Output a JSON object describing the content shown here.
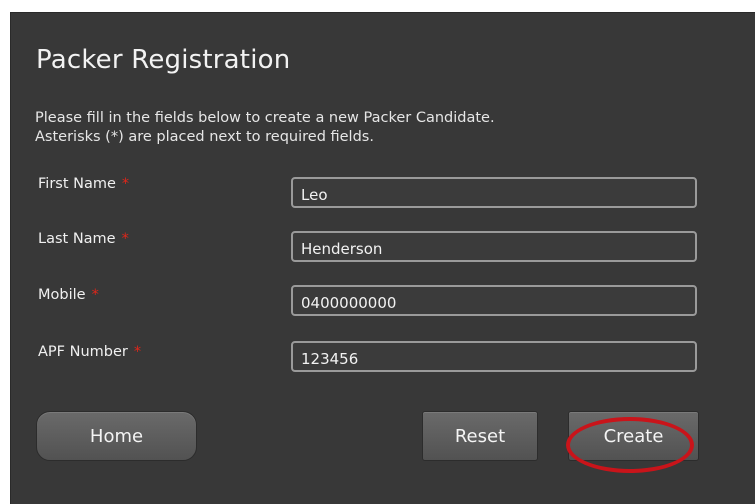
{
  "form": {
    "title": "Packer Registration",
    "instructions": [
      "Please fill in the fields below to create a new Packer Candidate.",
      "Asterisks (*) are placed next to required fields."
    ],
    "required_marker": "*",
    "fields": [
      {
        "label": "First Name",
        "value": "Leo"
      },
      {
        "label": "Last Name",
        "value": "Henderson"
      },
      {
        "label": "Mobile",
        "value": "0400000000"
      },
      {
        "label": "APF Number",
        "value": "123456"
      }
    ]
  },
  "buttons": {
    "home": "Home",
    "reset": "Reset",
    "create": "Create"
  },
  "colors": {
    "panel_background": "#383838",
    "required_asterisk": "#e0261a",
    "highlight_ring": "#c9141a"
  }
}
